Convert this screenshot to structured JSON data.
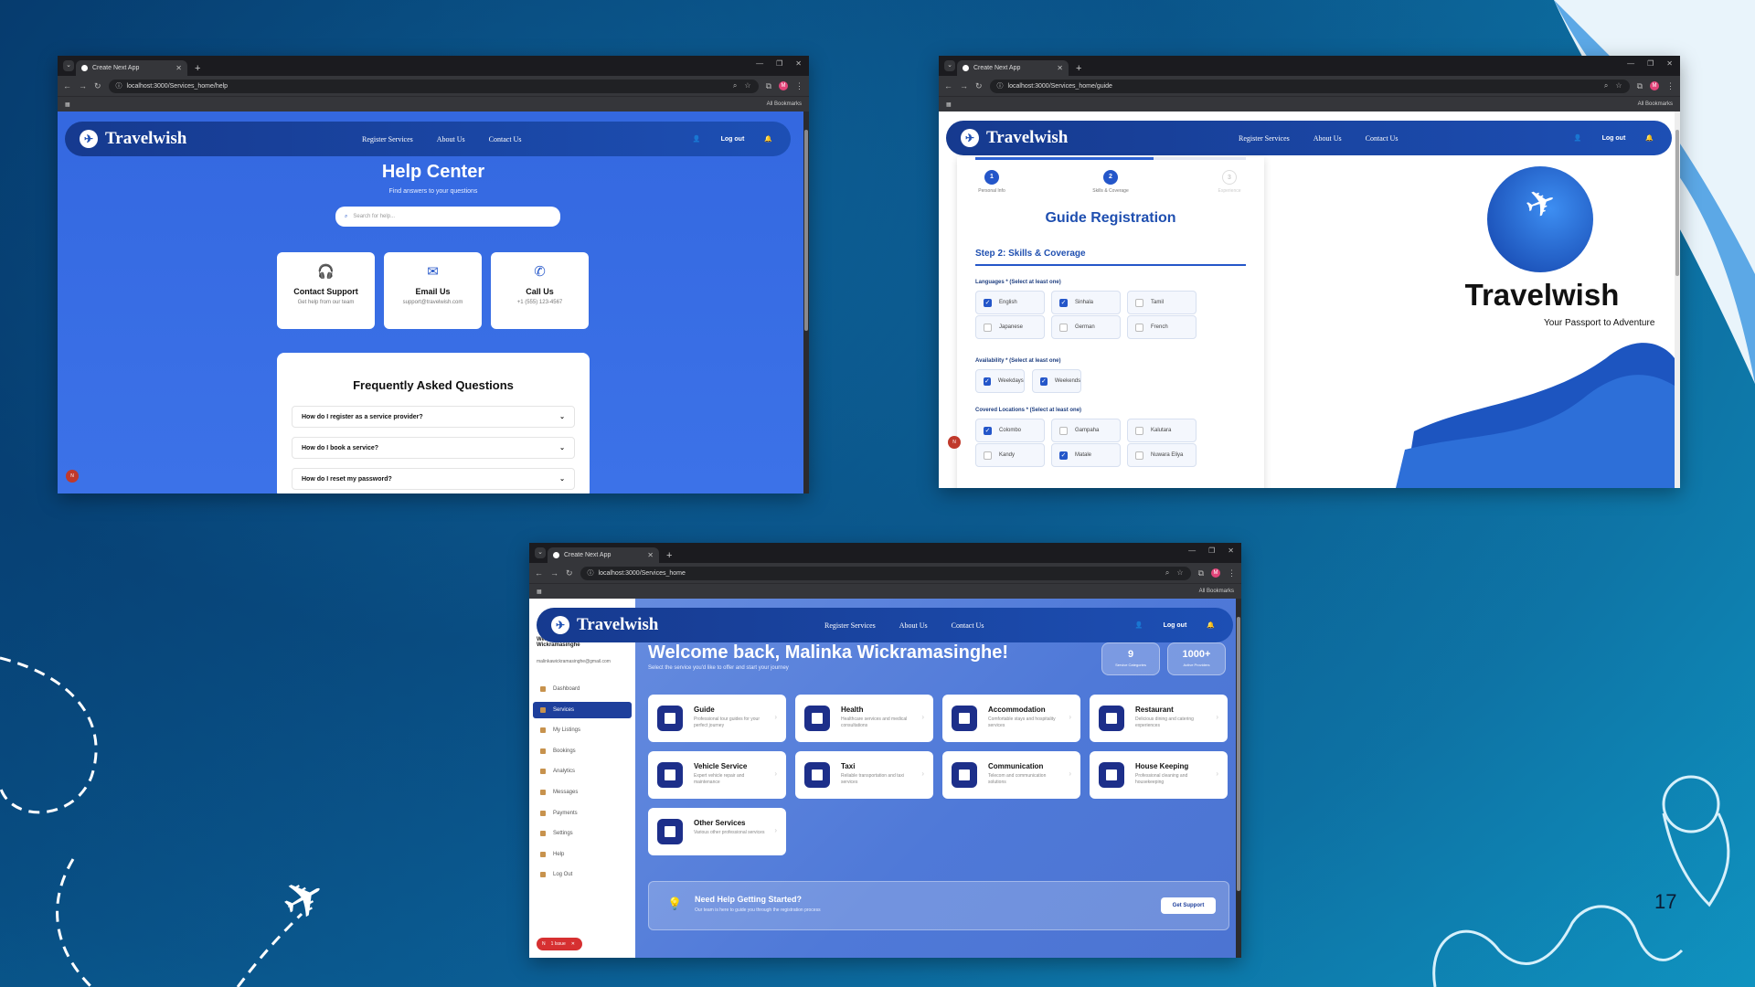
{
  "browser": {
    "tab_title": "Create Next App",
    "bookmarks_label": "All Bookmarks",
    "profile_initial": "M"
  },
  "window_help": {
    "url": "localhost:3000/Services_home/help",
    "brand": "Travelwish",
    "nav": [
      "Register Services",
      "About Us",
      "Contact Us"
    ],
    "logout": "Log out",
    "title": "Help Center",
    "subtitle": "Find answers to your questions",
    "search_placeholder": "Search for help...",
    "cards": [
      {
        "title": "Contact Support",
        "sub": "Get help from our team",
        "icon": "headset-icon"
      },
      {
        "title": "Email Us",
        "sub": "support@travelwish.com",
        "icon": "envelope-icon"
      },
      {
        "title": "Call Us",
        "sub": "+1 (555) 123-4567",
        "icon": "phone-icon"
      }
    ],
    "faq_title": "Frequently Asked Questions",
    "faq": [
      "How do I register as a service provider?",
      "How do I book a service?",
      "How do I reset my password?"
    ],
    "badge": "N"
  },
  "window_guide": {
    "url": "localhost:3000/Services_home/guide",
    "brand": "Travelwish",
    "nav": [
      "Register Services",
      "About Us",
      "Contact Us"
    ],
    "logout": "Log out",
    "progress": 0.66,
    "steps": [
      {
        "num": "1",
        "label": "Personal Info"
      },
      {
        "num": "2",
        "label": "Skills & Coverage"
      },
      {
        "num": "3",
        "label": "Experience"
      }
    ],
    "title": "Guide Registration",
    "step_heading": "Step 2: Skills & Coverage",
    "languages_label": "Languages * (Select at least one)",
    "languages": [
      {
        "name": "English",
        "checked": true
      },
      {
        "name": "Sinhala",
        "checked": true
      },
      {
        "name": "Tamil",
        "checked": false
      },
      {
        "name": "Japanese",
        "checked": false
      },
      {
        "name": "German",
        "checked": false
      },
      {
        "name": "French",
        "checked": false
      }
    ],
    "availability_label": "Availability * (Select at least one)",
    "availability": [
      {
        "name": "Weekdays",
        "checked": true
      },
      {
        "name": "Weekends",
        "checked": true
      }
    ],
    "locations_label": "Covered Locations * (Select at least one)",
    "locations": [
      {
        "name": "Colombo",
        "checked": true
      },
      {
        "name": "Gampaha",
        "checked": false
      },
      {
        "name": "Kalutara",
        "checked": false
      },
      {
        "name": "Kandy",
        "checked": false
      },
      {
        "name": "Matale",
        "checked": true
      },
      {
        "name": "Nuwara Eliya",
        "checked": false
      }
    ],
    "brand_big": "Travelwish",
    "tagline": "Your Passport to Adventure"
  },
  "window_dash": {
    "url": "localhost:3000/Services_home",
    "brand": "Travelwish",
    "nav": [
      "Register Services",
      "About Us",
      "Contact Us"
    ],
    "logout": "Log out",
    "sidebar_user": "Welcome, Malinka Wickramasinghe",
    "sidebar_email": "malinkawickramasinghe@gmail.com",
    "sidebar_items": [
      "Dashboard",
      "Services",
      "My Listings",
      "Bookings",
      "Analytics",
      "Messages",
      "Payments",
      "Settings",
      "Help",
      "Log Out"
    ],
    "active_item": "Services",
    "issue_badge": "1 Issue",
    "welcome": "Welcome back, Malinka Wickramasinghe!",
    "welcome_sub": "Select the service you'd like to offer and start your journey",
    "stats": [
      {
        "value": "9",
        "label": "Service Categories"
      },
      {
        "value": "1000+",
        "label": "Active Providers"
      }
    ],
    "services": [
      {
        "title": "Guide",
        "desc": "Professional tour guides for your perfect journey"
      },
      {
        "title": "Health",
        "desc": "Healthcare services and medical consultations"
      },
      {
        "title": "Accommodation",
        "desc": "Comfortable stays and hospitality services"
      },
      {
        "title": "Restaurant",
        "desc": "Delicious dining and catering experiences"
      },
      {
        "title": "Vehicle Service",
        "desc": "Expert vehicle repair and maintenance"
      },
      {
        "title": "Taxi",
        "desc": "Reliable transportation and taxi services"
      },
      {
        "title": "Communication",
        "desc": "Telecom and communication solutions"
      },
      {
        "title": "House Keeping",
        "desc": "Professional cleaning and housekeeping"
      },
      {
        "title": "Other Services",
        "desc": "Various other professional services"
      }
    ],
    "help_title": "Need Help Getting Started?",
    "help_desc": "Our team is here to guide you through the registration process",
    "help_btn": "Get Support"
  },
  "slide_number": "17",
  "colors": {
    "brand_blue": "#1d4fb4",
    "accent": "#2456c9"
  }
}
